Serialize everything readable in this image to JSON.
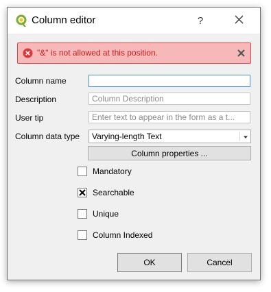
{
  "window": {
    "title": "Column editor",
    "help_glyph": "?"
  },
  "message": {
    "text": "\"&\" is not allowed at this position.",
    "color": "#c81a1a",
    "background": "#f6b8b8"
  },
  "form": {
    "column_name": {
      "label": "Column name",
      "value": ""
    },
    "description": {
      "label": "Description",
      "placeholder": "Column Description"
    },
    "user_tip": {
      "label": "User tip",
      "placeholder": "Enter text to appear in the form as a t..."
    },
    "data_type": {
      "label": "Column data type",
      "selected": "Varying-length Text"
    },
    "properties_button": "Column properties ..."
  },
  "checkboxes": [
    {
      "label": "Mandatory",
      "checked": false
    },
    {
      "label": "Searchable",
      "checked": true
    },
    {
      "label": "Unique",
      "checked": false
    },
    {
      "label": "Column Indexed",
      "checked": false
    }
  ],
  "buttons": {
    "ok": "OK",
    "cancel": "Cancel"
  },
  "colors": {
    "focus_border": "#3d8fd8",
    "error_border": "#e04545"
  }
}
